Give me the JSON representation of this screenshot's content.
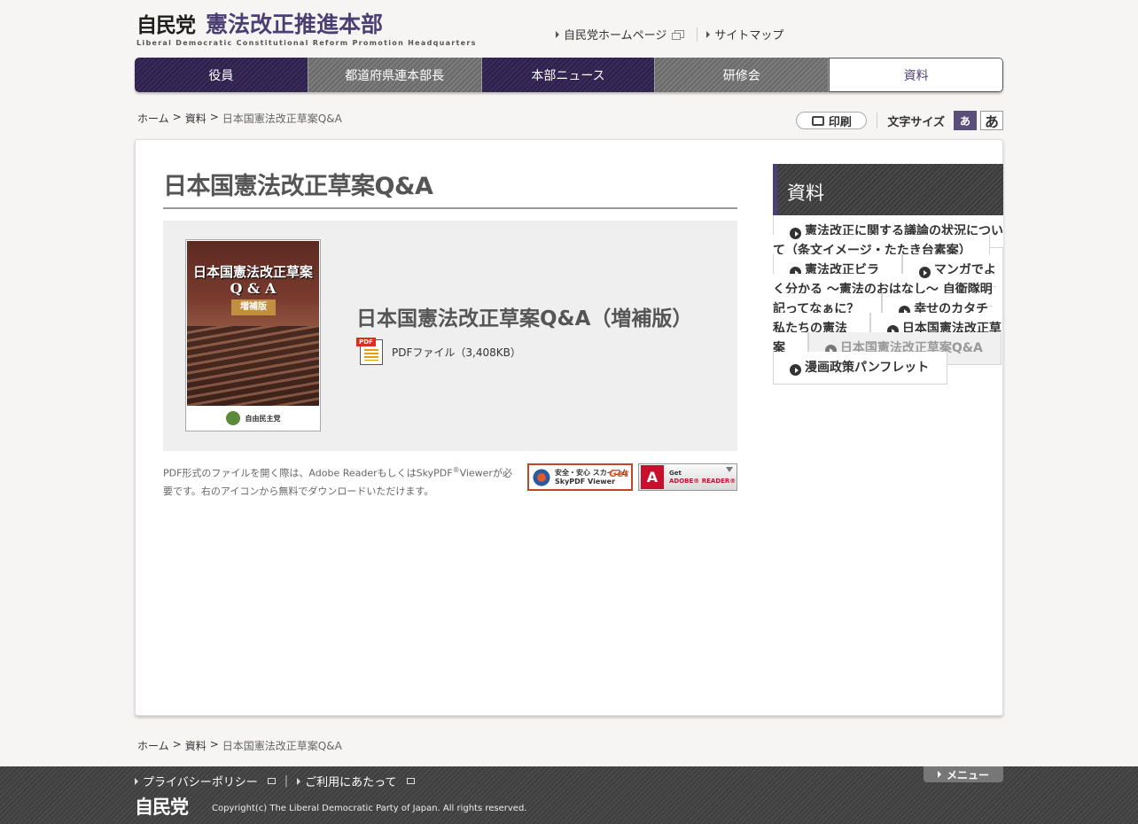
{
  "header": {
    "logo_ldp": "自民党",
    "logo_title": "憲法改正推進本部",
    "logo_sub": "Liberal Democratic Constitutional Reform Promotion Headquarters",
    "links": [
      "自民党ホームページ",
      "サイトマップ"
    ]
  },
  "nav": [
    "役員",
    "都道府県連本部長",
    "本部ニュース",
    "研修会",
    "資料"
  ],
  "breadcrumb": {
    "home": "ホーム",
    "sep": ">",
    "section": "資料",
    "current": "日本国憲法改正草案Q&A"
  },
  "tools": {
    "print_label": "印刷",
    "fontsize_label": "文字サイズ",
    "small": "あ",
    "large": "あ"
  },
  "main": {
    "title": "日本国憲法改正草案Q&A",
    "cover": {
      "title": "日本国憲法改正草案",
      "qa": "Q & A",
      "tag": "増補版",
      "publisher": "自由民主党"
    },
    "doc_title": "日本国憲法改正草案Q&A（増補版）",
    "pdf_tag": "PDF",
    "doc_file": "PDFファイル（3,408KB）",
    "notice_part1": "PDF形式のファイルを開く際は、Adobe ReaderもしくはSkyPDF",
    "notice_reg": "®",
    "notice_part2": "Viewerが必要です。右のアイコンから無料でダウンロードいただけます。",
    "sky_badge": {
      "line1": "安全・安心 スカイコム",
      "line2": "SkyPDF Viewer",
      "get": "Get"
    },
    "adobe_badge": {
      "line1": "Get",
      "line2": "ADOBE® READER®",
      "logo": "A"
    }
  },
  "side": {
    "title": "資料",
    "items": [
      "憲法改正に関する議論の状況について（条文イメージ・たたき台素案）",
      "憲法改正ビラ",
      "マンガでよく分かる ～憲法のおはなし～ 自衛隊明記ってなぁに？",
      "幸せのカタチ 私たちの憲法",
      "日本国憲法改正草案",
      "日本国憲法改正草案Q&A",
      "漫画政策パンフレット"
    ],
    "current_index": 5
  },
  "footer": {
    "links": [
      "プライバシーポリシー",
      "ご利用にあたって"
    ],
    "separator": "|",
    "logo": "自民党",
    "copyright": "Copyright(c) The Liberal Democratic Party of Japan. All rights reserved.",
    "menu": "メニュー"
  },
  "colors": {
    "accent": "#4c3f74",
    "nav_dark": "#2c2048",
    "nav_gray": "#6a6a6a",
    "footer": "#444444"
  }
}
